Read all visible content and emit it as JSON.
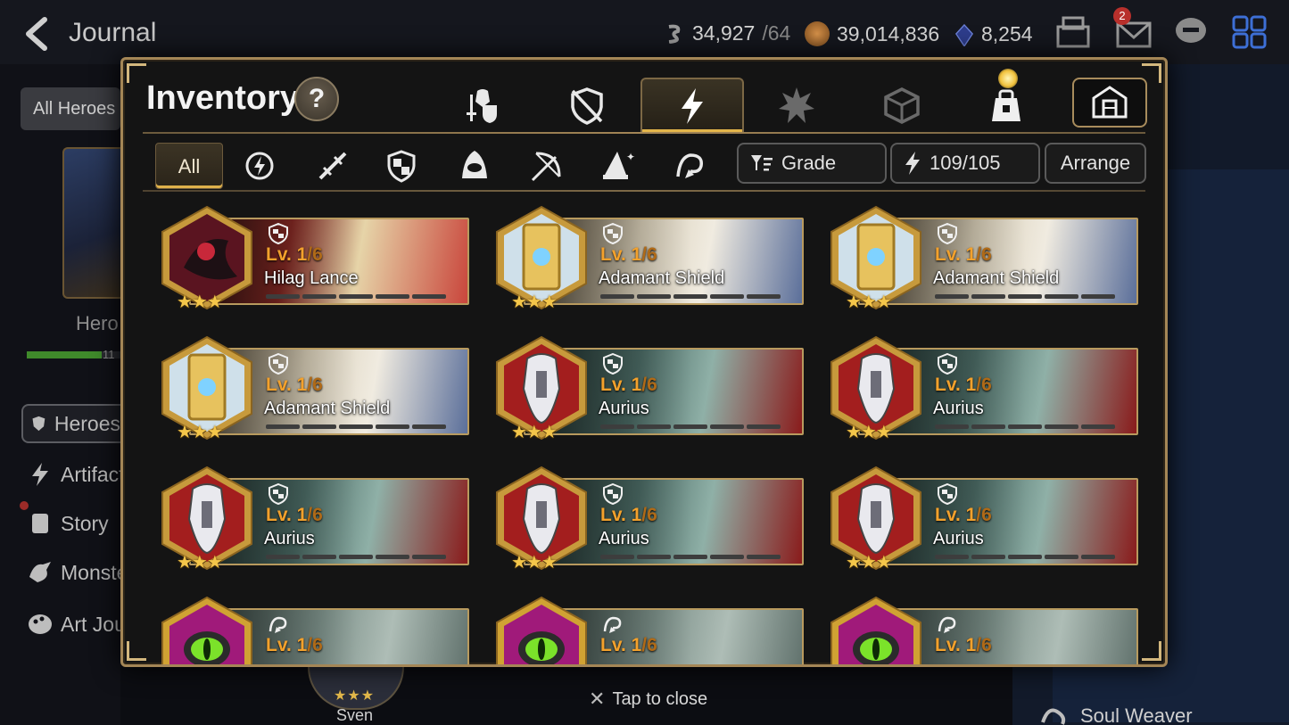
{
  "header": {
    "title": "Journal",
    "stamina": {
      "value": "34,927",
      "max": "/64"
    },
    "gold": "39,014,836",
    "skystones": "8,254",
    "mail_badge": "2"
  },
  "sidebar": {
    "filter_label": "All Heroes",
    "hero_label": "Hero",
    "progress_num": "11",
    "items": [
      {
        "label": "Heroes"
      },
      {
        "label": "Artifacts"
      },
      {
        "label": "Story"
      },
      {
        "label": "Monsters"
      },
      {
        "label": "Art Journal"
      }
    ]
  },
  "background": {
    "hero_name": "Sven",
    "hero_stars": "★★★",
    "right_item": "Soul Weaver"
  },
  "modal": {
    "title": "Inventory",
    "help": "?",
    "filter_all": "All",
    "sort_label": "Grade",
    "capacity": "109/105",
    "arrange_label": "Arrange",
    "tap_close": "Tap to close"
  },
  "colors": {
    "accent_gold": "#e3b54a",
    "level_orange": "#f3a12c",
    "frame": "#a48656"
  },
  "items": [
    {
      "name": "Hilag Lance",
      "level": "Lv. 1",
      "max": "/6",
      "stars": "★★★",
      "type": "shield",
      "theme": "hilag"
    },
    {
      "name": "Adamant Shield",
      "level": "Lv. 1",
      "max": "/6",
      "stars": "★★★",
      "type": "shield",
      "theme": "adamant"
    },
    {
      "name": "Adamant Shield",
      "level": "Lv. 1",
      "max": "/6",
      "stars": "★★★",
      "type": "shield",
      "theme": "adamant"
    },
    {
      "name": "Adamant Shield",
      "level": "Lv. 1",
      "max": "/6",
      "stars": "★★★",
      "type": "shield",
      "theme": "adamant"
    },
    {
      "name": "Aurius",
      "level": "Lv. 1",
      "max": "/6",
      "stars": "★★★",
      "type": "shield",
      "theme": "aurius"
    },
    {
      "name": "Aurius",
      "level": "Lv. 1",
      "max": "/6",
      "stars": "★★★",
      "type": "shield",
      "theme": "aurius"
    },
    {
      "name": "Aurius",
      "level": "Lv. 1",
      "max": "/6",
      "stars": "★★★",
      "type": "shield",
      "theme": "aurius"
    },
    {
      "name": "Aurius",
      "level": "Lv. 1",
      "max": "/6",
      "stars": "★★★",
      "type": "shield",
      "theme": "aurius"
    },
    {
      "name": "Aurius",
      "level": "Lv. 1",
      "max": "/6",
      "stars": "★★★",
      "type": "shield",
      "theme": "aurius"
    },
    {
      "name": "",
      "level": "Lv. 1",
      "max": "/6",
      "stars": "★★★",
      "type": "soul",
      "theme": "eye"
    },
    {
      "name": "",
      "level": "Lv. 1",
      "max": "/6",
      "stars": "★★★",
      "type": "soul",
      "theme": "eye"
    },
    {
      "name": "",
      "level": "Lv. 1",
      "max": "/6",
      "stars": "★★★",
      "type": "soul",
      "theme": "eye"
    }
  ]
}
